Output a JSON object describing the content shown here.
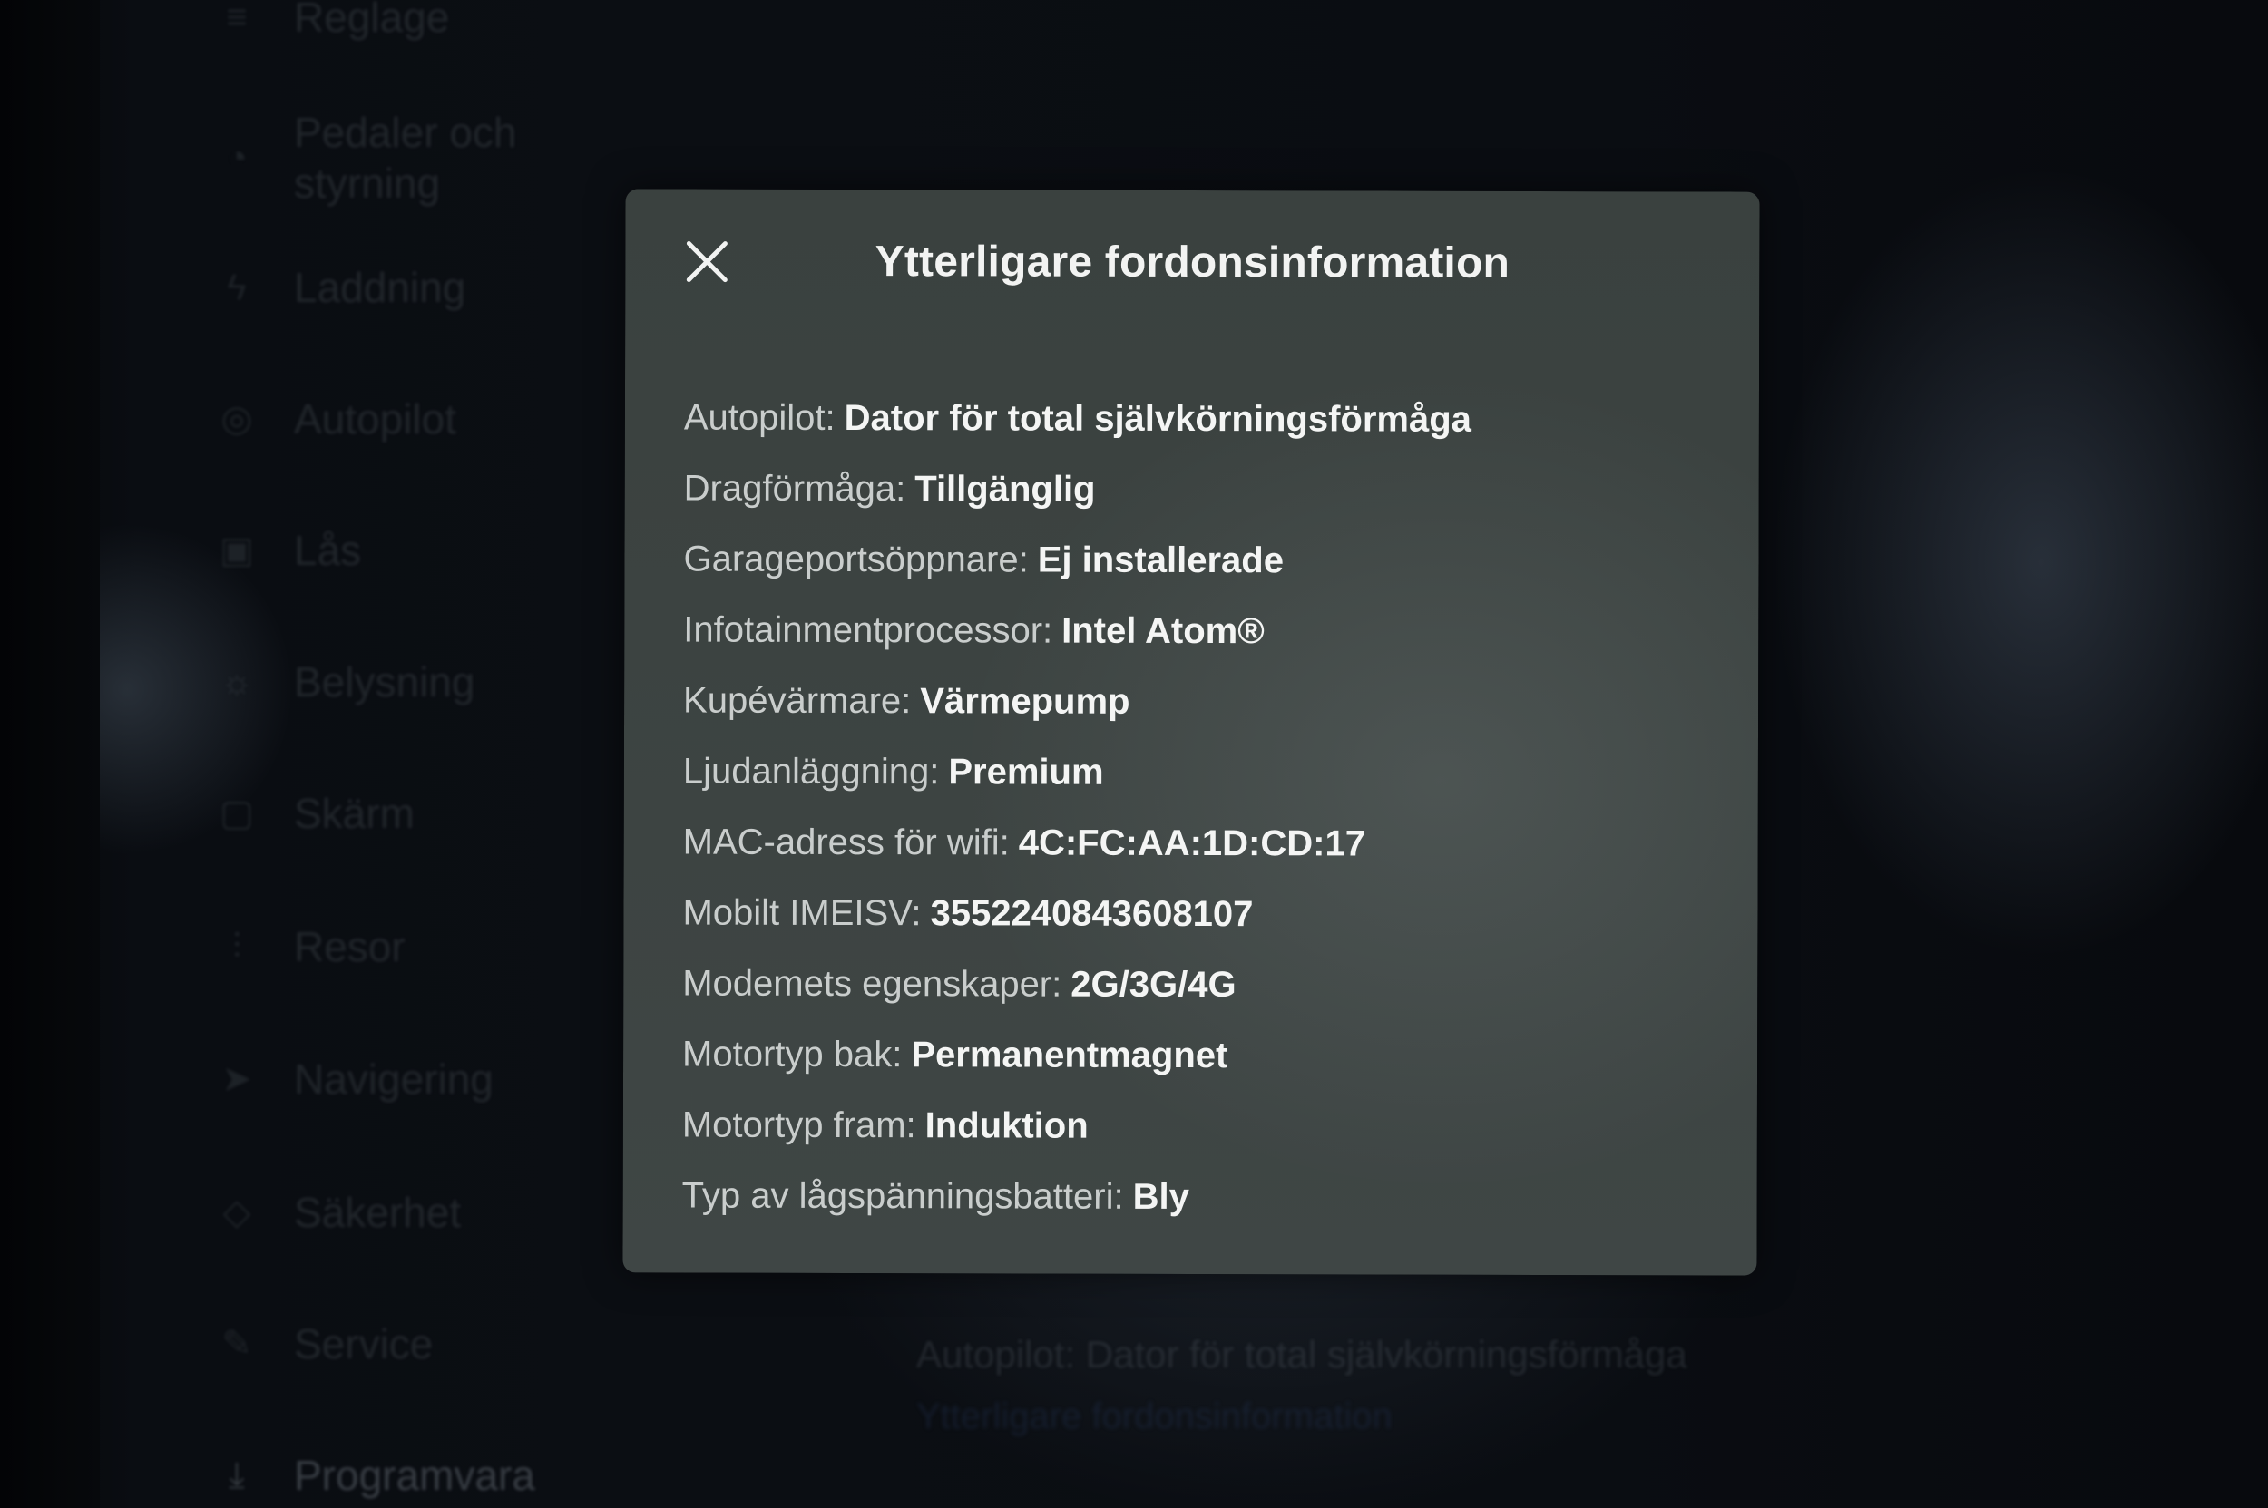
{
  "background": {
    "menu": [
      {
        "icon": "sliders-icon",
        "label": "Reglage"
      },
      {
        "icon": "car-icon",
        "label": "Pedaler och styrning"
      },
      {
        "icon": "lightning-icon",
        "label": "Laddning"
      },
      {
        "icon": "steering-wheel-icon",
        "label": "Autopilot"
      },
      {
        "icon": "lock-icon",
        "label": "Lås"
      },
      {
        "icon": "light-icon",
        "label": "Belysning"
      },
      {
        "icon": "display-icon",
        "label": "Skärm"
      },
      {
        "icon": "trips-icon",
        "label": "Resor"
      },
      {
        "icon": "navigation-icon",
        "label": "Navigering"
      },
      {
        "icon": "shield-icon",
        "label": "Säkerhet"
      },
      {
        "icon": "wrench-icon",
        "label": "Service"
      },
      {
        "icon": "download-icon",
        "label": "Programvara"
      }
    ],
    "detail_label": "Autopilot:",
    "detail_value": "Dator för total självkörningsförmåga",
    "detail_link": "Ytterligare fordonsinformation"
  },
  "modal": {
    "title": "Ytterligare fordonsinformation",
    "close_icon": "close-icon",
    "rows": [
      {
        "label": "Autopilot:",
        "value": "Dator för total självkörningsförmåga"
      },
      {
        "label": "Dragförmåga:",
        "value": "Tillgänglig"
      },
      {
        "label": "Garageportsöppnare:",
        "value": "Ej installerade"
      },
      {
        "label": "Infotainmentprocessor:",
        "value": "Intel Atom®"
      },
      {
        "label": "Kupévärmare:",
        "value": "Värmepump"
      },
      {
        "label": "Ljudanläggning:",
        "value": "Premium"
      },
      {
        "label": "MAC-adress för wifi:",
        "value": "4C:FC:AA:1D:CD:17"
      },
      {
        "label": "Mobilt IMEISV:",
        "value": "3552240843608107"
      },
      {
        "label": "Modemets egenskaper:",
        "value": "2G/3G/4G"
      },
      {
        "label": "Motortyp bak:",
        "value": "Permanentmagnet"
      },
      {
        "label": "Motortyp fram:",
        "value": "Induktion"
      },
      {
        "label": "Typ av lågspänningsbatteri:",
        "value": "Bly"
      }
    ]
  },
  "colors": {
    "modal_bg": "#3c4341",
    "title_text": "#f2f3f2",
    "label_text": "#c9cdcc",
    "value_text": "#f4f5f4",
    "screen_bg": "#0a0d12"
  }
}
